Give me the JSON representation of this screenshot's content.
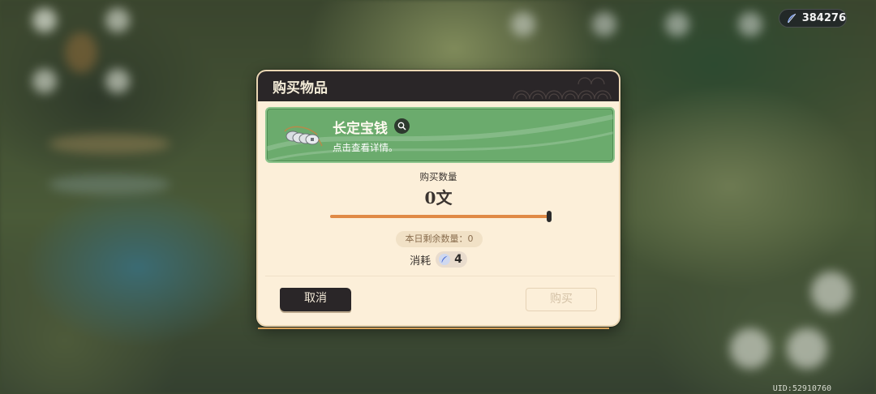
{
  "hud": {
    "currency_icon": "blue-feather-icon",
    "currency_amount": "384276",
    "uid_text": "UID:52910760"
  },
  "dialog": {
    "title": "购买物品",
    "item": {
      "name": "长定宝钱",
      "description": "点击查看详情。",
      "icon": "coin-string-icon"
    },
    "quantity_label": "购买数量",
    "quantity_value": "0文",
    "slider_level_fraction": 1.0,
    "remaining_text": "本日剩余数量：0",
    "cost_label": "消耗",
    "cost_icon": "blue-feather-icon",
    "cost_amount": "4",
    "cancel_label": "取消",
    "buy_label": "购买"
  },
  "colors": {
    "banner_green": "#6bab6d",
    "header_dark": "#2a2628",
    "panel_cream": "#fcefd9",
    "slider_orange": "#e08a45"
  }
}
